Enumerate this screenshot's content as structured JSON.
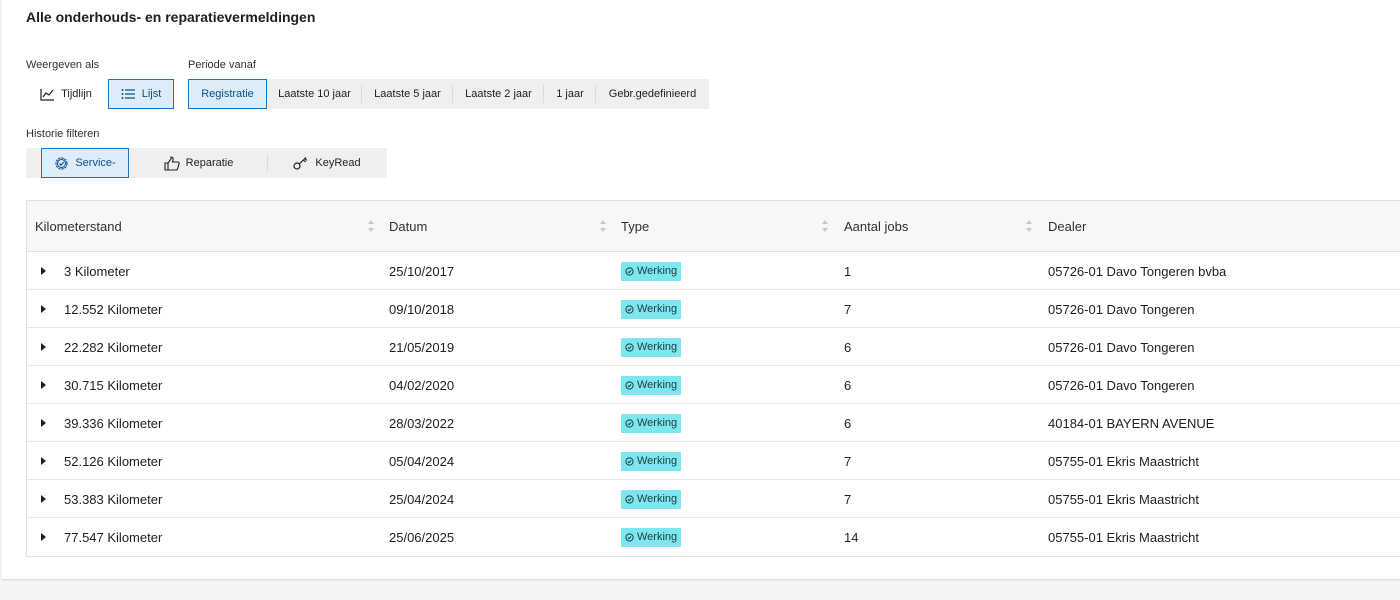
{
  "page": {
    "title": "Alle onderhouds- en reparatievermeldingen"
  },
  "view": {
    "label": "Weergeven als",
    "options": [
      {
        "label": "Tijdlijn",
        "icon": "line-chart-icon",
        "active": false
      },
      {
        "label": "Lijst",
        "icon": "list-icon",
        "active": true
      }
    ]
  },
  "period": {
    "label": "Periode vanaf",
    "options": [
      {
        "label": "Registratie",
        "active": true
      },
      {
        "label": "Laatste 10 jaar",
        "active": false
      },
      {
        "label": "Laatste 5 jaar",
        "active": false
      },
      {
        "label": "Laatste 2 jaar",
        "active": false
      },
      {
        "label": "1 jaar",
        "active": false
      },
      {
        "label": "Gebr.gedefinieerd",
        "active": false
      }
    ]
  },
  "filter": {
    "label": "Historie filteren",
    "options": [
      {
        "label": "Service-",
        "icon": "service-gear-icon",
        "active": true
      },
      {
        "label": "Reparatie",
        "icon": "thumbs-up-icon",
        "active": false
      },
      {
        "label": "KeyRead",
        "icon": "key-icon",
        "active": false
      }
    ]
  },
  "table": {
    "columns": [
      "Kilometerstand",
      "Datum",
      "Type",
      "Aantal jobs",
      "Dealer"
    ],
    "rows": [
      {
        "km": "3 Kilometer",
        "date": "25/10/2017",
        "type": "Werking",
        "jobs": "1",
        "dealer": "05726-01 Davo Tongeren bvba"
      },
      {
        "km": "12.552 Kilometer",
        "date": "09/10/2018",
        "type": "Werking",
        "jobs": "7",
        "dealer": "05726-01 Davo Tongeren"
      },
      {
        "km": "22.282 Kilometer",
        "date": "21/05/2019",
        "type": "Werking",
        "jobs": "6",
        "dealer": "05726-01 Davo Tongeren"
      },
      {
        "km": "30.715 Kilometer",
        "date": "04/02/2020",
        "type": "Werking",
        "jobs": "6",
        "dealer": "05726-01 Davo Tongeren"
      },
      {
        "km": "39.336 Kilometer",
        "date": "28/03/2022",
        "type": "Werking",
        "jobs": "6",
        "dealer": "40184-01 BAYERN AVENUE"
      },
      {
        "km": "52.126 Kilometer",
        "date": "05/04/2024",
        "type": "Werking",
        "jobs": "7",
        "dealer": "05755-01 Ekris Maastricht"
      },
      {
        "km": "53.383 Kilometer",
        "date": "25/04/2024",
        "type": "Werking",
        "jobs": "7",
        "dealer": "05755-01 Ekris Maastricht"
      },
      {
        "km": "77.547 Kilometer",
        "date": "25/06/2025",
        "type": "Werking",
        "jobs": "14",
        "dealer": "05755-01 Ekris Maastricht"
      }
    ]
  },
  "colors": {
    "accent": "#1b74c5",
    "active_bg": "#dcecf8",
    "badge_bg": "#7ee6ee"
  }
}
